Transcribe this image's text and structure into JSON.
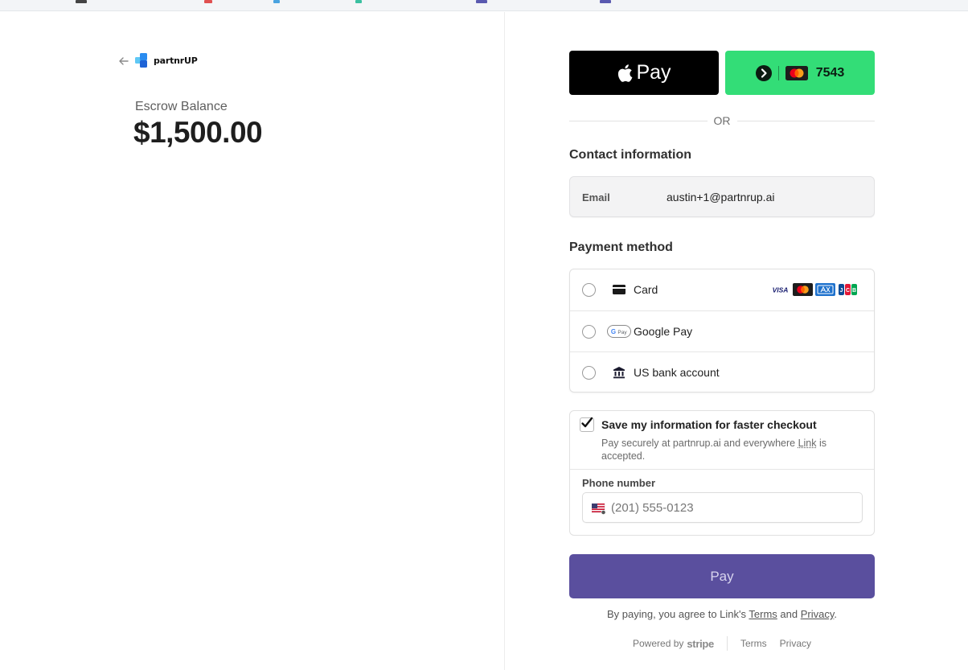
{
  "merchant": {
    "brand_name": "partnrUP",
    "balance_label": "Escrow Balance",
    "balance_amount": "$1,500.00"
  },
  "express": {
    "apple_pay_label": "Pay",
    "link_card_last4": "7543"
  },
  "divider_text": "OR",
  "contact": {
    "title": "Contact information",
    "email_label": "Email",
    "email_value": "austin+1@partnrup.ai"
  },
  "payment": {
    "title": "Payment method",
    "methods": [
      {
        "label": "Card",
        "icon": "card-icon",
        "selected": false
      },
      {
        "label": "Google Pay",
        "icon": "google-pay-icon",
        "selected": false
      },
      {
        "label": "US bank account",
        "icon": "bank-icon",
        "selected": false
      }
    ],
    "card_brands": [
      "visa",
      "mastercard",
      "amex",
      "jcb"
    ]
  },
  "save_info": {
    "checked": true,
    "title": "Save my information for faster checkout",
    "desc_before": "Pay securely at partnrup.ai and everywhere ",
    "desc_link": "Link",
    "desc_after": " is accepted.",
    "phone_label": "Phone number",
    "phone_placeholder": "(201) 555-0123"
  },
  "pay_button": "Pay",
  "legal": {
    "prefix": "By paying, you agree to Link's ",
    "terms": "Terms",
    "and": " and ",
    "privacy": "Privacy",
    "suffix": "."
  },
  "footer": {
    "powered_by": "Powered by",
    "stripe": "stripe",
    "terms": "Terms",
    "privacy": "Privacy"
  },
  "colors": {
    "link_green": "#33dd77",
    "pay_button": "#5a4f9e",
    "brand_blue": "#2a8cf0"
  }
}
